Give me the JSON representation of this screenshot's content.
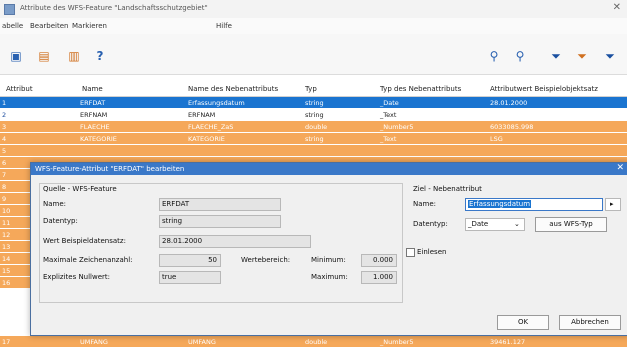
{
  "window": {
    "title": "Attribute des WFS-Feature \"Landschaftsschutzgebiet\"",
    "close": "✕"
  },
  "menu": [
    "abelle",
    "Bearbeiten",
    "Markieren",
    "Hilfe"
  ],
  "columns": [
    "Attribut",
    "Name",
    "Name des Nebenattributs",
    "Typ",
    "Typ des Nebenattributs",
    "Attributwert Beispielobjektsatz"
  ],
  "rows": [
    {
      "n": "1",
      "name": "ERFDAT",
      "neben": "Erfassungsdatum",
      "typ": "string",
      "ntyp": "_Date",
      "wert": "28.01.2000",
      "style": "sel"
    },
    {
      "n": "2",
      "name": "ERFNAM",
      "neben": "ERFNAM",
      "typ": "string",
      "ntyp": "_Text",
      "wert": "",
      "style": "white"
    },
    {
      "n": "3",
      "name": "FLAECHE",
      "neben": "FLAECHE_ZaS",
      "typ": "double",
      "ntyp": "_Number5",
      "wert": "6033085.998",
      "style": ""
    },
    {
      "n": "4",
      "name": "KATEGORIE",
      "neben": "KATEGORIE",
      "typ": "string",
      "ntyp": "_Text",
      "wert": "LSG",
      "style": ""
    },
    {
      "n": "5",
      "name": "",
      "neben": "",
      "typ": "",
      "ntyp": "",
      "wert": "",
      "style": ""
    },
    {
      "n": "6",
      "name": "",
      "neben": "",
      "typ": "",
      "ntyp": "",
      "wert": "",
      "style": ""
    },
    {
      "n": "7",
      "name": "",
      "neben": "",
      "typ": "",
      "ntyp": "",
      "wert": "",
      "style": ""
    },
    {
      "n": "8",
      "name": "",
      "neben": "",
      "typ": "",
      "ntyp": "",
      "wert": "",
      "style": ""
    },
    {
      "n": "9",
      "name": "",
      "neben": "",
      "typ": "",
      "ntyp": "",
      "wert": "",
      "style": ""
    },
    {
      "n": "10",
      "name": "",
      "neben": "",
      "typ": "",
      "ntyp": "",
      "wert": "",
      "style": ""
    },
    {
      "n": "11",
      "name": "",
      "neben": "",
      "typ": "",
      "ntyp": "",
      "wert": "",
      "style": ""
    },
    {
      "n": "12",
      "name": "",
      "neben": "",
      "typ": "",
      "ntyp": "",
      "wert": "",
      "style": ""
    },
    {
      "n": "13",
      "name": "",
      "neben": "",
      "typ": "",
      "ntyp": "",
      "wert": "",
      "style": ""
    },
    {
      "n": "14",
      "name": "",
      "neben": "",
      "typ": "",
      "ntyp": "",
      "wert": "",
      "style": ""
    },
    {
      "n": "15",
      "name": "",
      "neben": "",
      "typ": "",
      "ntyp": "",
      "wert": "",
      "style": ""
    },
    {
      "n": "16",
      "name": "",
      "neben": "",
      "typ": "",
      "ntyp": "",
      "wert": "",
      "style": ""
    },
    {
      "n": "17",
      "name": "UMFANG",
      "neben": "UMFANG",
      "typ": "double",
      "ntyp": "_Number5",
      "wert": "39461.127",
      "style": ""
    }
  ],
  "dialog": {
    "title": "WFS-Feature-Attribut \"ERFDAT\" bearbeiten",
    "close": "✕",
    "source": {
      "group": "Quelle - WFS-Feature",
      "name_label": "Name:",
      "name_value": "ERFDAT",
      "type_label": "Datentyp:",
      "type_value": "string",
      "example_label": "Wert Beispieldatensatz:",
      "example_value": "28.01.2000",
      "maxchars_label": "Maximale Zeichenanzahl:",
      "maxchars_value": "50",
      "range_label": "Wertebereich:",
      "min_label": "Minimum:",
      "min_value": "0.000",
      "max_label": "Maximum:",
      "max_value": "1.000",
      "nullable_label": "Explizites Nullwert:",
      "nullable_value": "true"
    },
    "target": {
      "group": "Ziel - Nebenattribut",
      "name_label": "Name:",
      "name_value": "Erfassungsdatum",
      "type_label": "Datentyp:",
      "type_value": "_Date",
      "type_button": "aus WFS-Typ",
      "import_label": "Einlesen"
    },
    "ok": "OK",
    "cancel": "Abbrechen"
  }
}
